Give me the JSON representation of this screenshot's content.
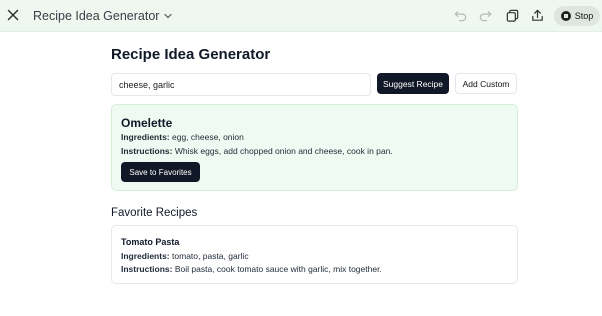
{
  "app": {
    "title": "Recipe Idea Generator",
    "stop_label": "Stop"
  },
  "main": {
    "heading": "Recipe Idea Generator",
    "search": {
      "value": "cheese, garlic",
      "placeholder": ""
    },
    "suggest_label": "Suggest Recipe",
    "add_custom_label": "Add Custom"
  },
  "suggestion": {
    "name": "Omelette",
    "ingredients_label": "Ingredients:",
    "ingredients": "egg, cheese, onion",
    "instructions_label": "Instructions:",
    "instructions": "Whisk eggs, add chopped onion and cheese, cook in pan.",
    "save_label": "Save to Favorites"
  },
  "favorites": {
    "heading": "Favorite Recipes",
    "items": [
      {
        "name": "Tomato Pasta",
        "ingredients_label": "Ingredients:",
        "ingredients": "tomato, pasta, garlic",
        "instructions_label": "Instructions:",
        "instructions": "Boil pasta, cook tomato sauce with garlic, mix together."
      }
    ]
  },
  "colors": {
    "topbar_bg": "#eef8f0",
    "primary_button": "#101827",
    "suggestion_bg": "#effaf2",
    "suggestion_border": "#d6efd9"
  },
  "icons": {
    "close": "close-icon",
    "chevron": "chevron-down-icon",
    "undo": "undo-icon",
    "redo": "redo-icon",
    "copy": "copy-icon",
    "share": "share-icon",
    "stop": "stop-icon"
  }
}
